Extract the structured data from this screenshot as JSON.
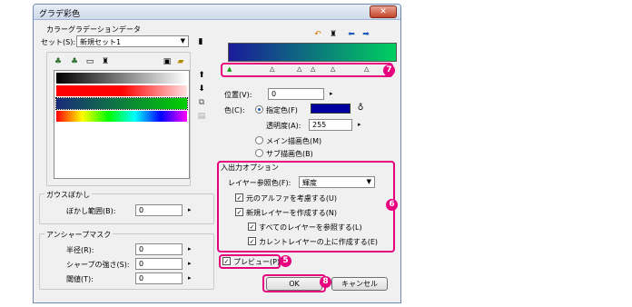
{
  "dialog": {
    "title": "グラデ彩色",
    "close": "✕"
  },
  "color_gradient_data": {
    "group_label": "カラーグラデーションデータ",
    "set_label": "セット(S):",
    "set_value": "新規セット1",
    "toolbar_icons": [
      "add-icon",
      "add-copy-icon",
      "edit-icon",
      "delete-icon",
      "save-icon",
      "open-folder-icon"
    ]
  },
  "gradient_swatches": [
    {
      "name": "black-white",
      "stops": [
        "#000000",
        "#ffffff"
      ]
    },
    {
      "name": "red-white",
      "stops": [
        "#ff0000",
        "#ff0000",
        "#ffe0e0"
      ]
    },
    {
      "name": "blue-green",
      "stops": [
        "#1a2a7a",
        "#00d000"
      ]
    },
    {
      "name": "rainbow",
      "stops": [
        "#ff0000",
        "#ffff00",
        "#00ff00",
        "#00ffff",
        "#0000ff",
        "#ff00ff"
      ]
    }
  ],
  "gaussian_blur": {
    "group_label": "ガウスぼかし",
    "range_label": "ぼかし範囲(B):",
    "range_value": "0"
  },
  "unsharp_mask": {
    "group_label": "アンシャープマスク",
    "radius_label": "半径(R):",
    "radius_value": "0",
    "sharpness_label": "シャープの強さ(S):",
    "sharpness_value": "0",
    "threshold_label": "閾値(T):",
    "threshold_value": "0"
  },
  "gradient_editor": {
    "preview_stops": [
      "#1a1a9a",
      "#00d060"
    ],
    "node_markers": [
      "▲",
      "△",
      "△",
      "△",
      "△",
      "△"
    ]
  },
  "node": {
    "position_label": "位置(V):",
    "position_value": "0",
    "color_label": "色(C):",
    "specified_color_label": "指定色(F)",
    "specified_color_value": "#0000a0",
    "opacity_label": "透明度(A):",
    "opacity_value": "255",
    "main_color_label": "メイン描画色(M)",
    "sub_color_label": "サブ描画色(B)"
  },
  "io_options": {
    "group_label": "入出力オプション",
    "ref_layer_label": "レイヤー参照色(F):",
    "ref_layer_value": "輝度",
    "consider_alpha_label": "元のアルファを考慮する(U)",
    "new_layer_label": "新規レイヤーを作成する(N)",
    "ref_all_layers_label": "すべてのレイヤーを参照する(L)",
    "create_above_label": "カレントレイヤーの上に作成する(E)",
    "consider_alpha_checked": true,
    "new_layer_checked": true,
    "ref_all_layers_checked": true,
    "create_above_checked": true
  },
  "preview": {
    "label": "プレビュー(P)",
    "checked": true
  },
  "buttons": {
    "ok": "OK",
    "cancel": "キャンセル"
  },
  "badges": {
    "b5": "5",
    "b6": "6",
    "b7": "7",
    "b8": "8"
  },
  "colors": {
    "highlight": "#e6007e",
    "accent": "#1d58b8"
  }
}
